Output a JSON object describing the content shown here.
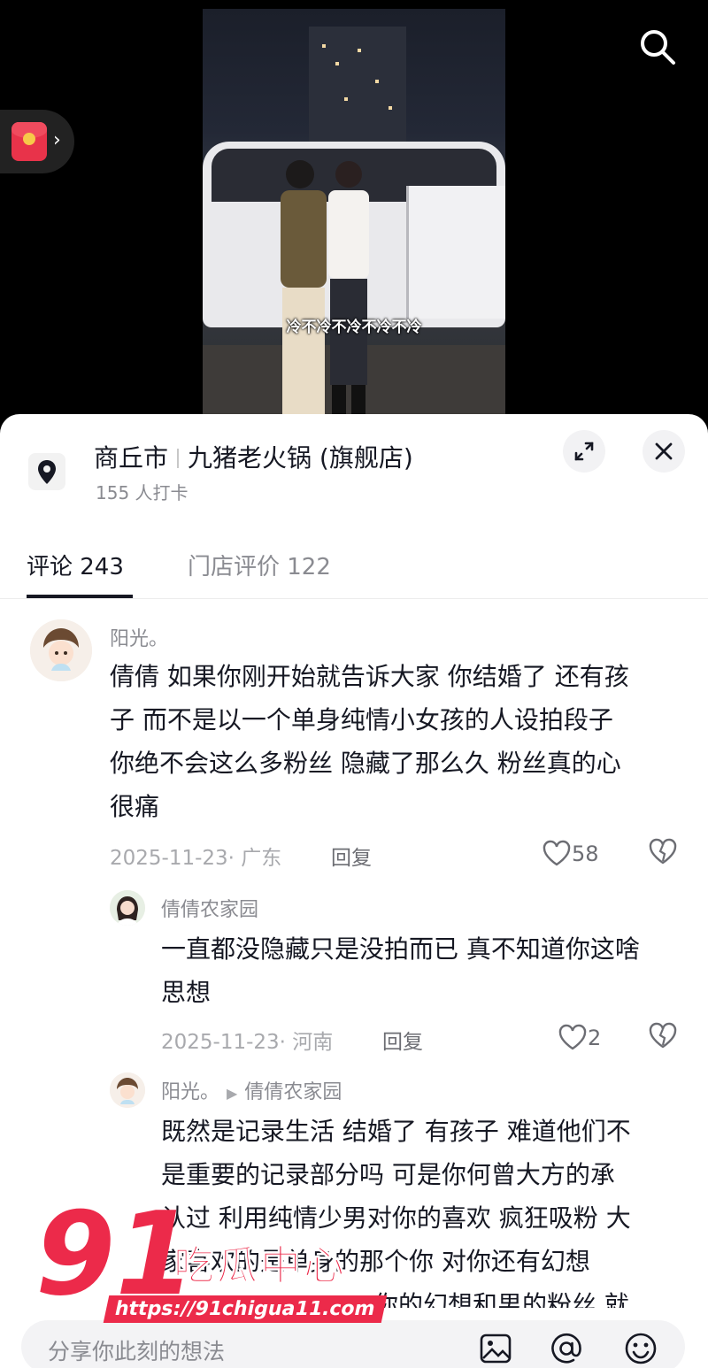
{
  "video": {
    "subtitle": "冷不冷不冷不冷不冷"
  },
  "location": {
    "city": "商丘市",
    "store": "九猪老火锅 (旗舰店)",
    "checkins": "155 人打卡"
  },
  "tabs": [
    {
      "label": "评论 243",
      "active": true
    },
    {
      "label": "门店评价 122",
      "active": false
    }
  ],
  "comments": [
    {
      "author": "阳光。",
      "lines": [
        "倩倩  如果你刚开始就告诉大家 你结婚了 还有孩",
        "子 而不是以一个单身纯情小女孩的人设拍段子",
        "你绝不会这么多粉丝 隐藏了那么久 粉丝真的心",
        "很痛"
      ],
      "meta": "2025-11-23· 广东",
      "reply_label": "回复",
      "likes": "58"
    },
    {
      "author": "倩倩农家园",
      "lines": [
        "一直都没隐藏只是没拍而已 真不知道你这啥",
        "思想"
      ],
      "meta": "2025-11-23· 河南",
      "reply_label": "回复",
      "likes": "2"
    },
    {
      "author": "阳光。",
      "reply_to": "倩倩农家园",
      "lines": [
        "既然是记录生活 结婚了 有孩子  难道他们不",
        "是重要的记录部分吗  可是你何曾大方的承",
        "认过  利用纯情少男对你的喜欢 疯狂吸粉  大",
        "家喜欢的是单身的那个你 对你还有幻想",
        "你的幻想和男的粉丝  就"
      ]
    }
  ],
  "watermark": {
    "num": "91",
    "cn": "吃瓜中心",
    "url": "https://91chigua11.com"
  },
  "input": {
    "placeholder": "分享你此刻的想法"
  },
  "icons": {
    "search": "search-icon",
    "red_packet": "red-packet-icon",
    "location": "location-pin-icon",
    "expand": "expand-icon",
    "close": "close-icon",
    "heart": "heart-icon",
    "dislike": "broken-heart-icon",
    "image": "image-icon",
    "at": "at-icon",
    "emoji": "emoji-icon"
  },
  "colors": {
    "accent": "#ec2a4a",
    "text": "#161823",
    "secondary": "#8a8b91"
  }
}
